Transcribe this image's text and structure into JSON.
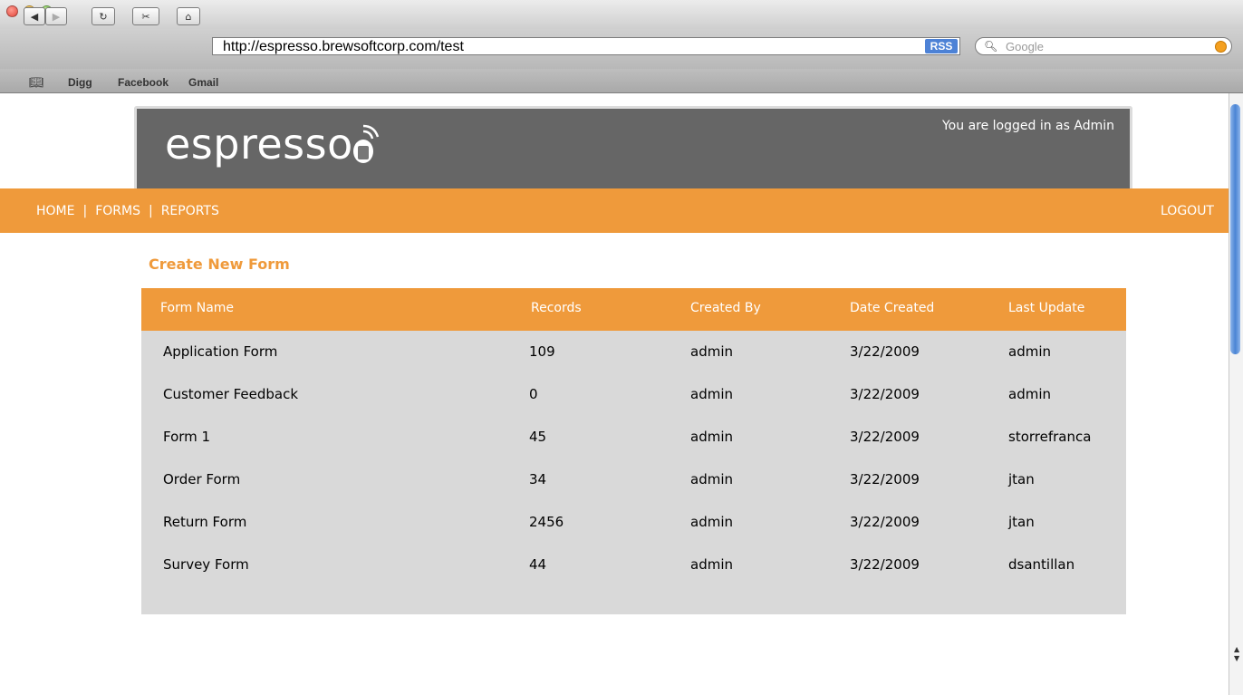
{
  "browser": {
    "url": "http://espresso.brewsoftcorp.com/test",
    "rss_label": "RSS",
    "search_placeholder": "Google",
    "bookmarks": [
      "Digg",
      "Facebook",
      "Gmail"
    ]
  },
  "site": {
    "logo": "espresso",
    "logged_in_text": "You are logged in as Admin",
    "nav": [
      "HOME",
      "FORMS",
      "REPORTS"
    ],
    "nav_separator": "|",
    "logout": "LOGOUT",
    "create_link": "Create New Form",
    "accent_color": "#ef9a3b"
  },
  "table": {
    "headers": [
      "Form Name",
      "Records",
      "Created By",
      "Date Created",
      "Last Update"
    ],
    "rows": [
      [
        "Application Form",
        "109",
        "admin",
        "3/22/2009",
        "admin"
      ],
      [
        "Customer Feedback",
        "0",
        "admin",
        "3/22/2009",
        "admin"
      ],
      [
        "Form 1",
        "45",
        "admin",
        "3/22/2009",
        "storrefranca"
      ],
      [
        "Order Form",
        "34",
        "admin",
        "3/22/2009",
        "jtan"
      ],
      [
        "Return Form",
        "2456",
        "admin",
        "3/22/2009",
        "jtan"
      ],
      [
        "Survey Form",
        "44",
        "admin",
        "3/22/2009",
        "dsantillan"
      ]
    ]
  }
}
